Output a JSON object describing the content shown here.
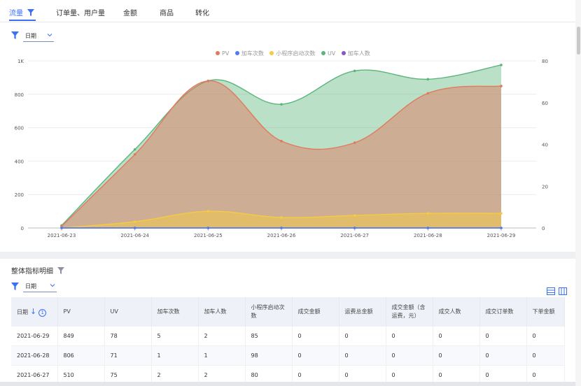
{
  "tabs": [
    {
      "label": "流量",
      "active": true
    },
    {
      "label": "订单量、用户量",
      "active": false
    },
    {
      "label": "金额",
      "active": false
    },
    {
      "label": "商品",
      "active": false
    },
    {
      "label": "转化",
      "active": false
    }
  ],
  "chart_section": {
    "dimension": "日期"
  },
  "chart_data": {
    "type": "area",
    "x": [
      "2021-06-23",
      "2021-06-24",
      "2021-06-25",
      "2021-06-26",
      "2021-06-27",
      "2021-06-28",
      "2021-06-29"
    ],
    "series": [
      {
        "name": "PV",
        "axis": "left",
        "color": "#e07a5f",
        "values": [
          10,
          440,
          880,
          520,
          510,
          806,
          849
        ]
      },
      {
        "name": "加车次数",
        "axis": "right",
        "color": "#4e7cf0",
        "values": [
          0,
          0,
          0,
          0,
          0,
          0,
          0
        ]
      },
      {
        "name": "小程序启动次数",
        "axis": "right",
        "color": "#f5cb42",
        "values": [
          0,
          3,
          8,
          5,
          6,
          7,
          7
        ]
      },
      {
        "name": "UV",
        "axis": "left",
        "color": "#5bb57a",
        "values": [
          15,
          470,
          880,
          740,
          940,
          890,
          975
        ]
      },
      {
        "name": "加车人数",
        "axis": "right",
        "color": "#8855cc",
        "values": [
          0,
          0,
          0,
          0,
          0,
          0,
          0
        ]
      }
    ],
    "y_left": {
      "min": 0,
      "max": 1000,
      "ticks": [
        "0",
        "200",
        "400",
        "600",
        "800",
        "1K"
      ]
    },
    "y_right": {
      "min": 0,
      "max": 80,
      "ticks": [
        "0",
        "20",
        "40",
        "60",
        "80"
      ]
    },
    "legend": "top-center",
    "grid": true
  },
  "detail": {
    "title": "整体指标明细",
    "dimension": "日期",
    "columns": [
      "日期",
      "PV",
      "UV",
      "加车次数",
      "加车人数",
      "小程序启动次数",
      "成交金额",
      "运费总金额",
      "成交金额（含运费，元）",
      "成交人数",
      "成交订单数",
      "下单金额"
    ],
    "sort_info": "1",
    "rows": [
      [
        "2021-06-29",
        "849",
        "78",
        "5",
        "2",
        "85",
        "0",
        "0",
        "0",
        "0",
        "0",
        "0"
      ],
      [
        "2021-06-28",
        "806",
        "71",
        "1",
        "1",
        "98",
        "0",
        "0",
        "0",
        "0",
        "0",
        "0"
      ],
      [
        "2021-06-27",
        "510",
        "75",
        "2",
        "2",
        "80",
        "0",
        "0",
        "0",
        "0",
        "0",
        "0"
      ]
    ]
  },
  "colors": {
    "accent": "#3a6ff7"
  }
}
